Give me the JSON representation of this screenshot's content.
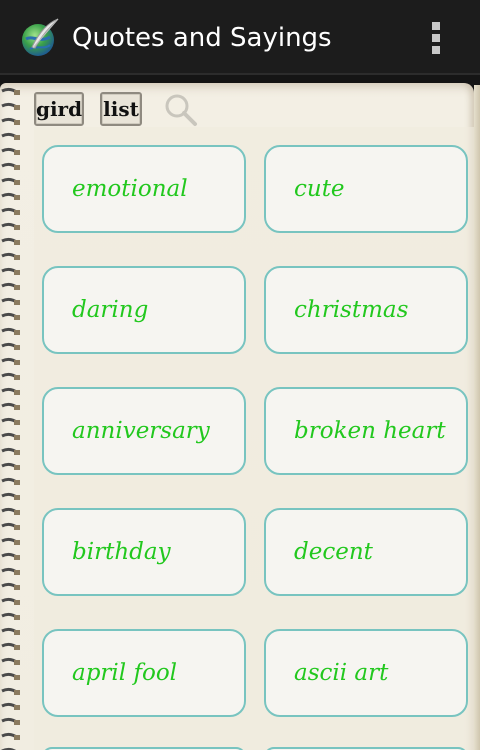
{
  "app": {
    "title": "Quotes and Sayings",
    "icon": "globe-feather-icon"
  },
  "toolbar": {
    "grid_label": "gird",
    "list_label": "list",
    "search_icon": "magnifier-icon"
  },
  "categories": [
    {
      "label": "emotional"
    },
    {
      "label": "cute"
    },
    {
      "label": "daring"
    },
    {
      "label": "christmas"
    },
    {
      "label": "anniversary"
    },
    {
      "label": "broken heart"
    },
    {
      "label": "birthday"
    },
    {
      "label": "decent"
    },
    {
      "label": "april fool"
    },
    {
      "label": "ascii art"
    }
  ],
  "colors": {
    "category_text": "#22c81e",
    "cell_border": "#78c4c0",
    "action_bar": "#1c1c1c",
    "paper": "#f3efe4"
  }
}
